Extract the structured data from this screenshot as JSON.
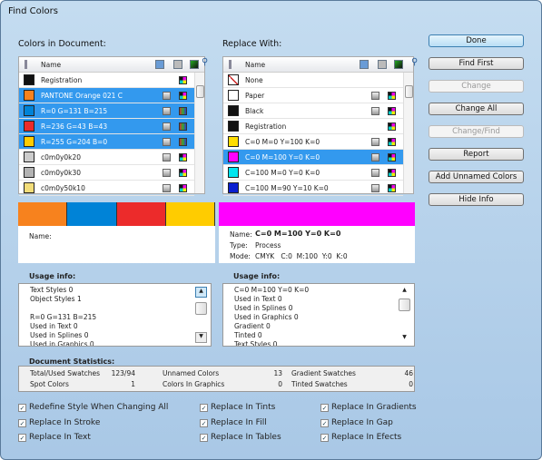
{
  "window": {
    "title": "Find Colors"
  },
  "left": {
    "label": "Colors in Document:",
    "col_name": "Name",
    "rows": [
      {
        "name": "Registration",
        "color": "#111111",
        "selected": false,
        "icons": [
          "x"
        ]
      },
      {
        "name": "PANTONE Orange 021 C",
        "color": "#f7821e",
        "selected": true,
        "icons": [
          "spot",
          "x"
        ]
      },
      {
        "name": "R=0 G=131 B=215",
        "color": "#0083d7",
        "selected": true,
        "icons": [
          "gray",
          "rgb"
        ]
      },
      {
        "name": "R=236 G=43 B=43",
        "color": "#ec2b2b",
        "selected": true,
        "icons": [
          "gray",
          "rgb"
        ]
      },
      {
        "name": "R=255 G=204 B=0",
        "color": "#ffcc00",
        "selected": true,
        "icons": [
          "gray",
          "rgb"
        ]
      },
      {
        "name": "c0m0y0k20",
        "color": "#cccccc",
        "selected": false,
        "icons": [
          "gray",
          "x"
        ]
      },
      {
        "name": "c0m0y0k30",
        "color": "#b3b3b3",
        "selected": false,
        "icons": [
          "gray",
          "x"
        ]
      },
      {
        "name": "c0m0y50k10",
        "color": "#f2dd7a",
        "selected": false,
        "icons": [
          "gray",
          "x"
        ]
      }
    ],
    "preview_colors": [
      "#f7821e",
      "#0083d7",
      "#ec2b2b",
      "#ffcc00"
    ],
    "info_name_label": "Name:",
    "usage_label": "Usage info:",
    "usage_text": "Text Styles 0\nObject Styles 1\n\nR=0 G=131 B=215\nUsed in Text 0\nUsed in Splines 0\nUsed in Graphics 0"
  },
  "right": {
    "label": "Replace With:",
    "col_name": "Name",
    "rows": [
      {
        "name": "None",
        "color": "none",
        "selected": false,
        "icons": []
      },
      {
        "name": "Paper",
        "color": "#ffffff",
        "selected": false,
        "icons": [
          "gray",
          "x"
        ]
      },
      {
        "name": "Black",
        "color": "#111111",
        "selected": false,
        "icons": [
          "gray",
          "x"
        ]
      },
      {
        "name": "Registration",
        "color": "#111111",
        "selected": false,
        "icons": [
          "x"
        ]
      },
      {
        "name": "C=0 M=0 Y=100 K=0",
        "color": "#ffdd00",
        "selected": false,
        "icons": [
          "gray",
          "x"
        ]
      },
      {
        "name": "C=0 M=100 Y=0 K=0",
        "color": "#ff00ff",
        "selected": true,
        "icons": [
          "gray",
          "x"
        ]
      },
      {
        "name": "C=100 M=0 Y=0 K=0",
        "color": "#00e5ee",
        "selected": false,
        "icons": [
          "gray",
          "x"
        ]
      },
      {
        "name": "C=100 M=90 Y=10 K=0",
        "color": "#0a1ed0",
        "selected": false,
        "icons": [
          "gray",
          "x"
        ]
      }
    ],
    "preview_color": "#ff00ff",
    "info": {
      "name_label": "Name:",
      "name": "C=0 M=100 Y=0 K=0",
      "type_label": "Type:",
      "type": "Process",
      "mode_label": "Mode:",
      "mode": "CMYK   C:0  M:100  Y:0  K:0"
    },
    "usage_label": "Usage info:",
    "usage_text": "C=0 M=100 Y=0 K=0\nUsed in Text 0\nUsed in Splines 0\nUsed in Graphics 0\nGradient 0\nTinted 0\nText Styles 0"
  },
  "buttons": [
    {
      "label": "Done",
      "state": "default"
    },
    {
      "label": "Find First",
      "state": "enabled"
    },
    {
      "label": "Change",
      "state": "disabled"
    },
    {
      "label": "Change All",
      "state": "enabled"
    },
    {
      "label": "Change/Find",
      "state": "disabled"
    },
    {
      "label": "Report",
      "state": "enabled"
    },
    {
      "label": "Add Unnamed Colors",
      "state": "enabled"
    },
    {
      "label": "Hide Info",
      "state": "enabled"
    }
  ],
  "stats": {
    "label": "Document Statistics:",
    "items": [
      {
        "label": "Total/Used Swatches",
        "value": "123/94"
      },
      {
        "label": "Unnamed Colors",
        "value": "13"
      },
      {
        "label": "Gradient Swatches",
        "value": "46"
      },
      {
        "label": "Spot Colors",
        "value": "1"
      },
      {
        "label": "Colors In Graphics",
        "value": "0"
      },
      {
        "label": "Tinted Swatches",
        "value": "0"
      }
    ]
  },
  "options": [
    {
      "label": "Redefine Style When Changing All",
      "checked": true
    },
    {
      "label": "Replace In Tints",
      "checked": true
    },
    {
      "label": "Replace In Gradients",
      "checked": true
    },
    {
      "label": "Replace In Stroke",
      "checked": true
    },
    {
      "label": "Replace In Fill",
      "checked": true
    },
    {
      "label": "Replace In Gap",
      "checked": true
    },
    {
      "label": "Replace In Text",
      "checked": true
    },
    {
      "label": "Replace In Tables",
      "checked": true
    },
    {
      "label": "Replace In Efects",
      "checked": true
    }
  ]
}
